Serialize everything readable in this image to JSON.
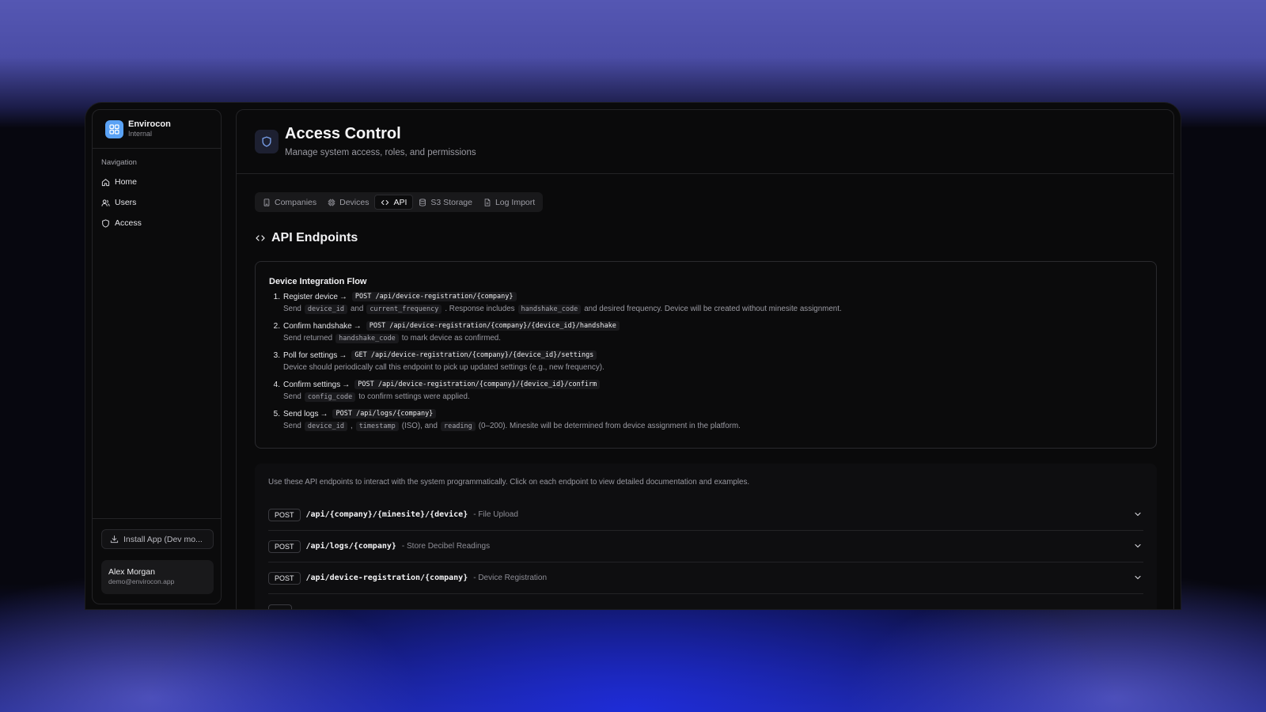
{
  "app": {
    "name": "Envirocon",
    "subtitle": "Internal"
  },
  "sidebar": {
    "heading": "Navigation",
    "items": [
      {
        "label": "Home",
        "icon": "home-icon"
      },
      {
        "label": "Users",
        "icon": "users-icon"
      },
      {
        "label": "Access",
        "icon": "shield-icon"
      }
    ],
    "install_label": "Install App (Dev mo...",
    "user": {
      "name": "Alex Morgan",
      "email": "demo@envirocon.app"
    }
  },
  "header": {
    "title": "Access Control",
    "subtitle": "Manage system access, roles, and permissions"
  },
  "tabs": [
    {
      "label": "Companies",
      "icon": "building-icon",
      "active": false
    },
    {
      "label": "Devices",
      "icon": "chip-icon",
      "active": false
    },
    {
      "label": "API",
      "icon": "code-icon",
      "active": true
    },
    {
      "label": "S3 Storage",
      "icon": "database-icon",
      "active": false
    },
    {
      "label": "Log Import",
      "icon": "file-icon",
      "active": false
    }
  ],
  "section": {
    "title": "API Endpoints"
  },
  "flow": {
    "title": "Device Integration Flow",
    "arrow": "→",
    "steps": [
      {
        "num": "1.",
        "label": "Register device",
        "endpoint": "POST /api/device-registration/{company}",
        "desc": {
          "a": "Send",
          "c1": "device_id",
          "b": "and",
          "c2": "current_frequency",
          "c": ". Response includes",
          "c3": "handshake_code",
          "d": "and desired frequency. Device will be created without minesite assignment."
        }
      },
      {
        "num": "2.",
        "label": "Confirm handshake",
        "endpoint": "POST /api/device-registration/{company}/{device_id}/handshake",
        "desc": {
          "a": "Send returned",
          "c1": "handshake_code",
          "b": "to mark device as confirmed."
        }
      },
      {
        "num": "3.",
        "label": "Poll for settings",
        "endpoint": "GET /api/device-registration/{company}/{device_id}/settings",
        "desc": {
          "a": "Device should periodically call this endpoint to pick up updated settings (e.g., new frequency)."
        }
      },
      {
        "num": "4.",
        "label": "Confirm settings",
        "endpoint": "POST /api/device-registration/{company}/{device_id}/confirm",
        "desc": {
          "a": "Send",
          "c1": "config_code",
          "b": "to confirm settings were applied."
        }
      },
      {
        "num": "5.",
        "label": "Send logs",
        "endpoint": "POST /api/logs/{company}",
        "desc": {
          "a": "Send",
          "c1": "device_id",
          "b": ",",
          "c2": "timestamp",
          "c": "(ISO), and",
          "c3": "reading",
          "d": "(0–200). Minesite will be determined from device assignment in the platform."
        }
      }
    ]
  },
  "endpoints": {
    "intro": "Use these API endpoints to interact with the system programmatically. Click on each endpoint to view detailed documentation and examples.",
    "items": [
      {
        "method": "POST",
        "path": "/api/{company}/{minesite}/{device}",
        "desc": "- File Upload"
      },
      {
        "method": "POST",
        "path": "/api/logs/{company}",
        "desc": "- Store Decibel Readings"
      },
      {
        "method": "POST",
        "path": "/api/device-registration/{company}",
        "desc": "- Device Registration"
      },
      {
        "method": "",
        "path": "",
        "desc": ""
      }
    ]
  }
}
